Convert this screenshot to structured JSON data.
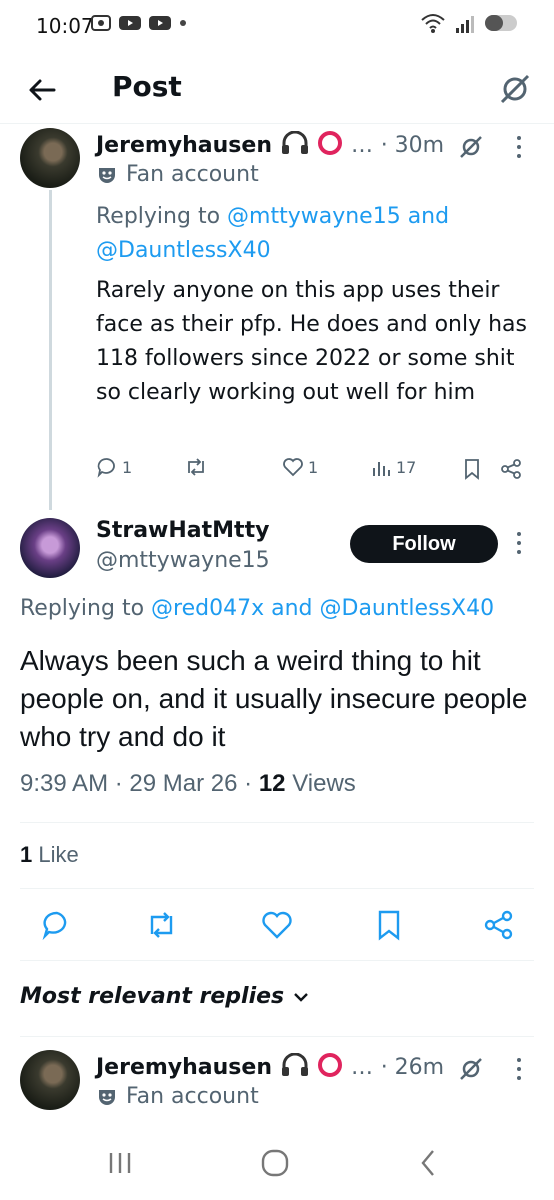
{
  "status_bar": {
    "time": "10:07"
  },
  "header": {
    "title": "Post"
  },
  "reply1": {
    "name": "Jeremyhausen",
    "time": "· 30m",
    "ellipsis": "…",
    "label": "Fan account",
    "replying_prefix": "Replying to",
    "replying_to_1": "@mttywayne15",
    "replying_and": "and",
    "replying_to_2": "@DauntlessX40",
    "text": "Rarely anyone on this app uses their face as their pfp. He does and only has 118 followers since 2022 or some shit so clearly working out well for him",
    "replies": "1",
    "reposts": "",
    "likes": "1",
    "views": "17"
  },
  "main": {
    "name": "StrawHatMtty",
    "handle": "@mttywayne15",
    "follow_label": "Follow",
    "replying_prefix": "Replying to",
    "replying_to_1": "@red047x",
    "replying_and": "and",
    "replying_to_2": "@DauntlessX40",
    "text": "Always been such a weird thing to hit people on, and it usually insecure people who try and do it",
    "time": "9:39 AM",
    "date": "29 Mar 26",
    "views_count": "12",
    "views_label": "Views",
    "likes_count": "1",
    "likes_label": "Like"
  },
  "relevant_label": "Most relevant replies",
  "reply2": {
    "name": "Jeremyhausen",
    "time": "· 26m",
    "ellipsis": "…",
    "label": "Fan account"
  },
  "colors": {
    "link": "#1d9bf0",
    "muted": "#536471",
    "text": "#0f1419"
  }
}
